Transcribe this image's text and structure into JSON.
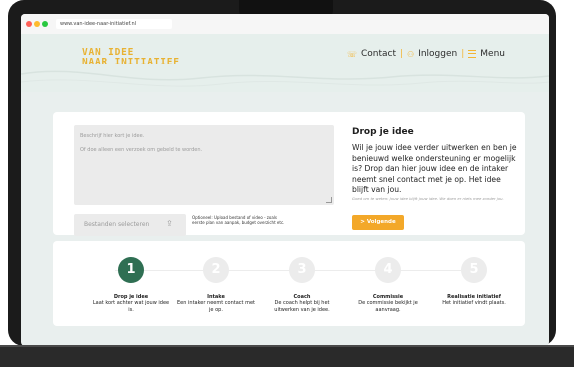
{
  "browser": {
    "url": "www.van-idee-naar-initiatief.nl"
  },
  "header": {
    "logo_line1": "VAN IDEE",
    "logo_line2": "NAAR INITIATIEF",
    "nav": {
      "contact": "Contact",
      "login": "Inloggen",
      "menu": "Menu"
    }
  },
  "form": {
    "placeholder_line1": "Beschrijf hier kort je idee.",
    "placeholder_line2": "Of doe alleen een verzoek om gebeld te worden.",
    "file_button": "Bestanden selecteren",
    "file_note": "Optioneel: Upload bestand of video - zoals eerste plan van aanpak, budget overzicht etc."
  },
  "intro": {
    "title": "Drop je idee",
    "body": "Wil je jouw idee verder uitwerken en ben je benieuwd welke ondersteuning er mogelijk is? Drop dan hier jouw idee en de intaker neemt snel contact met je op. Het idee blijft van jou.",
    "small": "Goed om te weten: Jouw idee blijft jouw idee. We doen er niets mee zonder jou.",
    "next_button": "> Volgende"
  },
  "steps": [
    {
      "number": "1",
      "title": "Drop je idee",
      "desc": "Laat kort achter wat jouw idee is.",
      "active": true
    },
    {
      "number": "2",
      "title": "Intake",
      "desc": "Een intaker neemt contact met je op.",
      "active": false
    },
    {
      "number": "3",
      "title": "Coach",
      "desc": "De coach helpt bij het uitwerken van je idee.",
      "active": false
    },
    {
      "number": "4",
      "title": "Commissie",
      "desc": "De commissie bekijkt je aanvraag.",
      "active": false
    },
    {
      "number": "5",
      "title": "Realisatie initiatief",
      "desc": "Het initiatief vindt plaats.",
      "active": false
    }
  ],
  "colors": {
    "accent": "#f3a829",
    "logo": "#e8b233",
    "active_step": "#2f6f53",
    "inactive_step": "#ececec",
    "background": "#e9efee"
  }
}
